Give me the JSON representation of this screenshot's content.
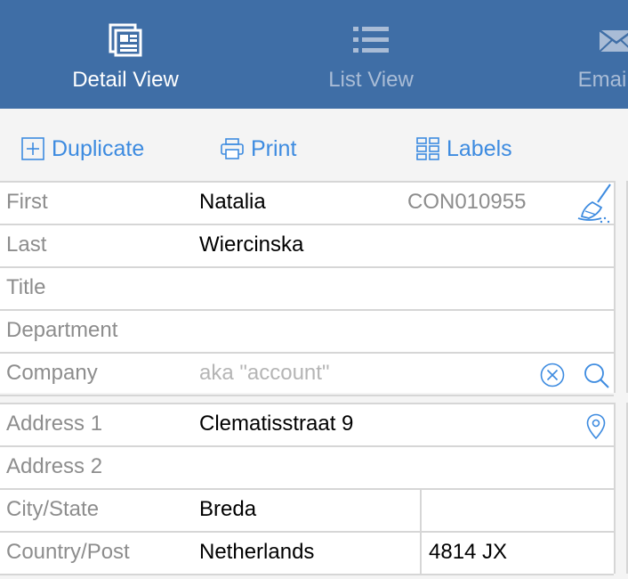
{
  "nav": {
    "tabs": [
      {
        "label": "Detail View",
        "icon": "detail-view-icon",
        "active": true
      },
      {
        "label": "List View",
        "icon": "list-view-icon",
        "active": false
      },
      {
        "label": "Email M",
        "icon": "envelope-icon",
        "active": false
      }
    ]
  },
  "toolbar": {
    "duplicate_label": "Duplicate",
    "print_label": "Print",
    "labels_label": "Labels"
  },
  "contact": {
    "first_label": "First",
    "first_value": "Natalia",
    "record_id": "CON010955",
    "last_label": "Last",
    "last_value": "Wiercinska",
    "title_label": "Title",
    "title_value": "",
    "department_label": "Department",
    "department_value": "",
    "company_label": "Company",
    "company_placeholder": "aka \"account\""
  },
  "address": {
    "address1_label": "Address 1",
    "address1_value": "Clematisstraat 9",
    "address2_label": "Address 2",
    "address2_value": "",
    "citystate_label": "City/State",
    "city_value": "Breda",
    "state_value": "",
    "countrypost_label": "Country/Post",
    "country_value": "Netherlands",
    "postcode_value": "4814 JX"
  },
  "colors": {
    "header_bg": "#3f6ea6",
    "accent": "#3d8be0",
    "label": "#8d8d8d"
  }
}
